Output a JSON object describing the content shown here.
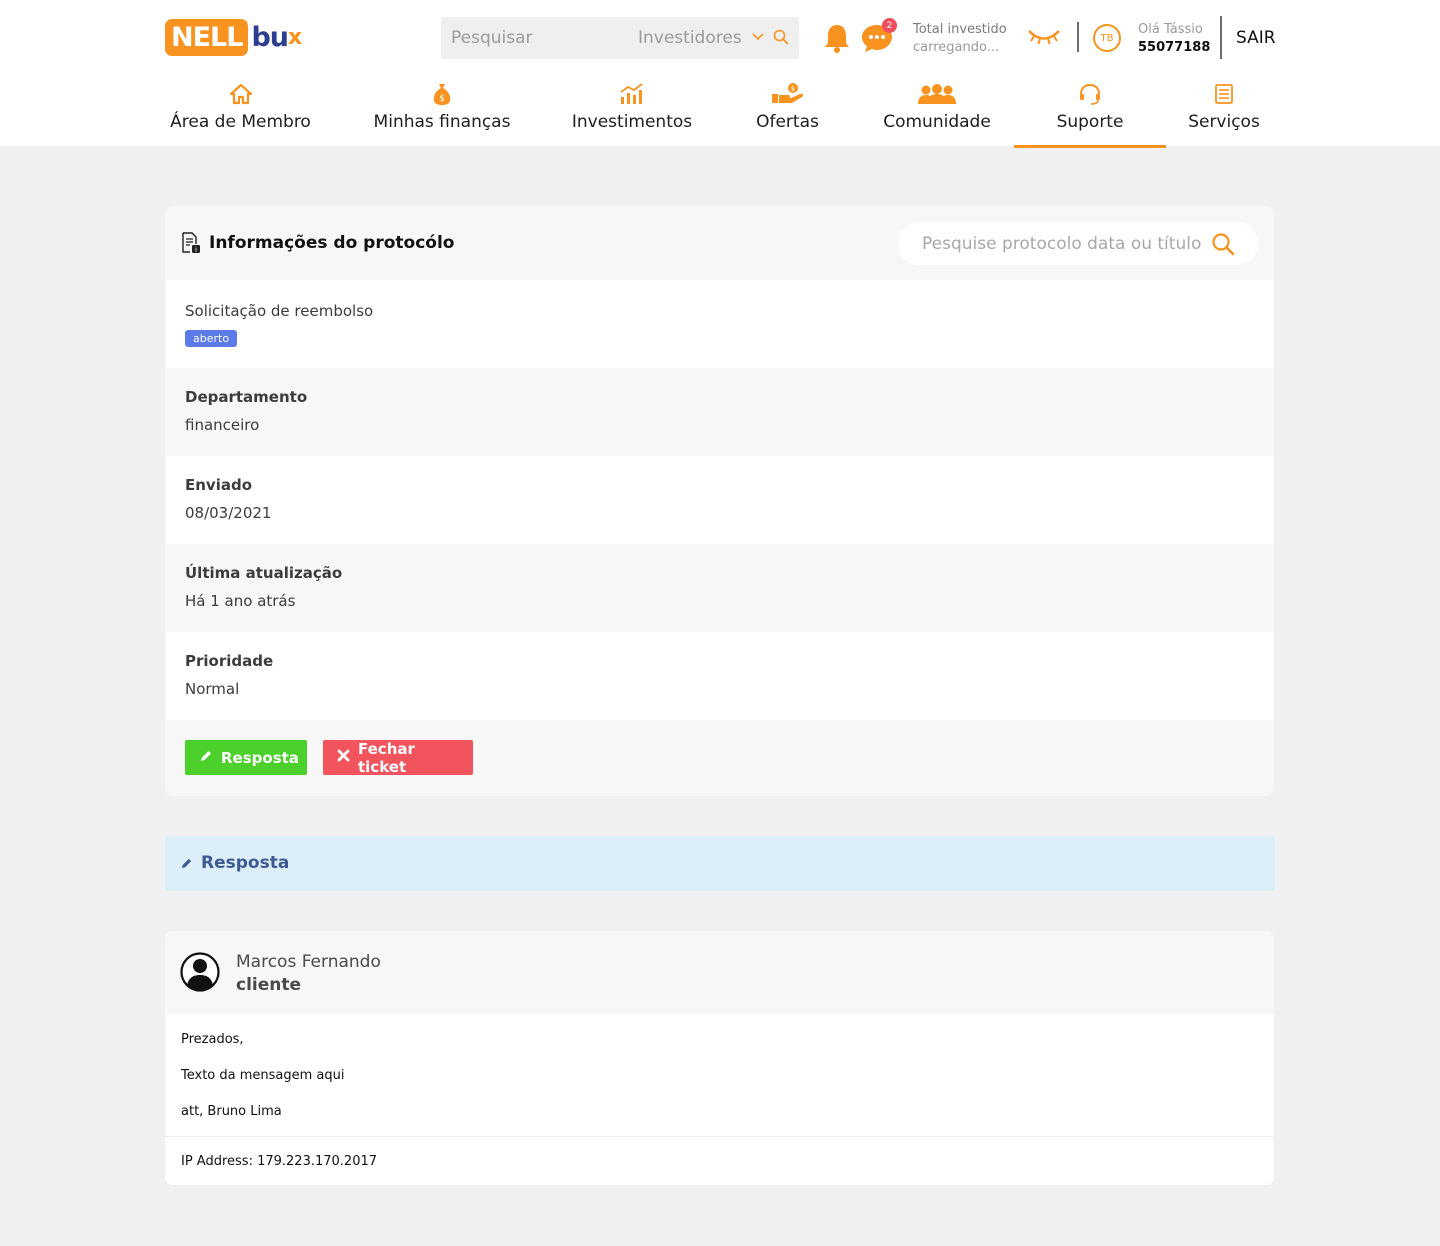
{
  "header": {
    "logo": {
      "part1": "NELL",
      "part2": "bu",
      "part3": "x"
    },
    "search_placeholder": "Pesquisar",
    "search_select": "Investidores",
    "chat_badge": "2",
    "total_label": "Total investido",
    "total_value": "carregando...",
    "avatar_initials": "TB",
    "hello": "Olá Tássio",
    "account_number": "55077188",
    "logout": "SAIR"
  },
  "nav": [
    {
      "label": "Área de Membro",
      "icon": "home-icon"
    },
    {
      "label": "Minhas finanças",
      "icon": "money-bag-icon"
    },
    {
      "label": "Investimentos",
      "icon": "chart-icon"
    },
    {
      "label": "Ofertas",
      "icon": "hand-coin-icon"
    },
    {
      "label": "Comunidade",
      "icon": "people-icon"
    },
    {
      "label": "Suporte",
      "icon": "headset-icon",
      "active": true
    },
    {
      "label": "Serviços",
      "icon": "document-icon"
    }
  ],
  "protocol": {
    "title": "Informações do protocólo",
    "search_placeholder": "Pesquise protocolo data ou título",
    "subject": "Solicitação de reembolso",
    "status": "aberto",
    "fields": [
      {
        "label": "Departamento",
        "value": "financeiro"
      },
      {
        "label": "Enviado",
        "value": "08/03/2021"
      },
      {
        "label": "Última atualização",
        "value": "Há 1 ano atrás"
      },
      {
        "label": "Prioridade",
        "value": "Normal"
      }
    ],
    "reply_button": "Resposta",
    "close_button": "Fechar ticket"
  },
  "reply_banner": {
    "label": "Resposta"
  },
  "message": {
    "author": "Marcos Fernando",
    "role": "cliente",
    "lines": [
      "Prezados,",
      "Texto da mensagem aqui",
      "att, Bruno Lima"
    ],
    "ip": "IP Address: 179.223.170.2017"
  },
  "colors": {
    "accent": "#f7931e",
    "brand_blue": "#2c3e8f",
    "status_tag": "#5a7be8",
    "reply_button": "#4cd12c",
    "close_button": "#f2545e",
    "banner": "#dceef8"
  }
}
